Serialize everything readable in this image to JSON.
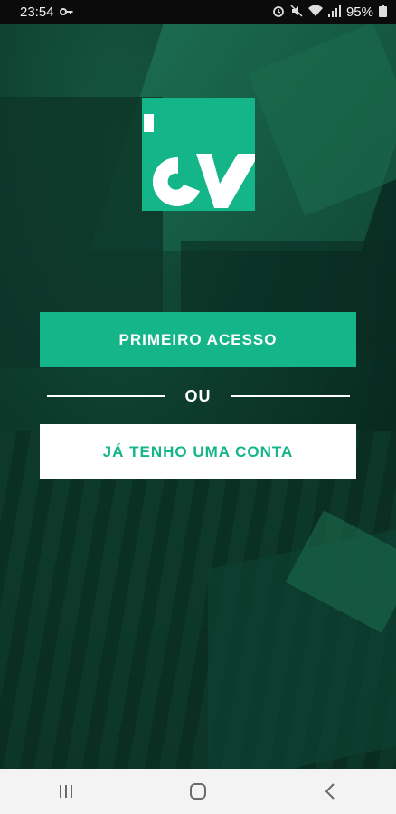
{
  "status_bar": {
    "time": "23:54",
    "battery": "95%",
    "icons": [
      "key-icon",
      "alarm-icon",
      "mute-icon",
      "wifi-icon",
      "signal-icon",
      "battery-icon"
    ]
  },
  "logo": {
    "icon": "cv-logo-icon",
    "color": "#13b589"
  },
  "actions": {
    "primary_label": "PRIMEIRO ACESSO",
    "divider_label": "OU",
    "secondary_label": "JÁ TENHO UMA CONTA"
  },
  "colors": {
    "accent": "#13b589",
    "white": "#ffffff"
  },
  "nav_bar": {
    "icons": [
      "recent-apps-icon",
      "home-icon",
      "back-icon"
    ]
  }
}
